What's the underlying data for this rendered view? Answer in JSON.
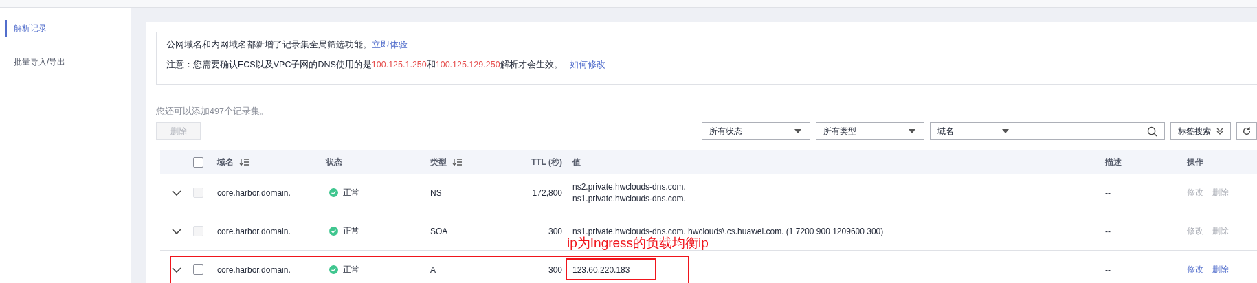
{
  "sidebar": {
    "items": [
      {
        "label": "解析记录",
        "selected": true
      },
      {
        "label": "批量导入/导出",
        "selected": false
      }
    ]
  },
  "notice": {
    "line_1": {
      "text": "公网域名和内网域名都新增了记录集全局筛选功能。",
      "link": "立即体验"
    },
    "line_2": {
      "parts": [
        {
          "kind": "text",
          "text": "注意：您需要确认ECS以及VPC子网的DNS使用的是"
        },
        {
          "kind": "highlight",
          "text": "100.125.1.250"
        },
        {
          "kind": "text",
          "text": "和"
        },
        {
          "kind": "highlight",
          "text": "100.125.129.250"
        },
        {
          "kind": "text",
          "text": "解析才会生效。"
        }
      ],
      "link": "如何修改"
    }
  },
  "quota": "您还可以添加497个记录集。",
  "delete_button": {
    "label": "删除",
    "disabled": true
  },
  "filters": {
    "status_select": "所有状态",
    "type_select": "所有类型",
    "search_scope": "域名",
    "tag_search": "标签搜索"
  },
  "table": {
    "select_all_checked": false,
    "columns": [
      {
        "label": "域名",
        "sortable": true
      },
      {
        "label": "状态",
        "sortable": false
      },
      {
        "label": "类型",
        "sortable": true
      },
      {
        "label": "TTL (秒)",
        "sortable": false
      },
      {
        "label": "值",
        "sortable": false
      },
      {
        "label": "描述",
        "sortable": false
      },
      {
        "label": "操作",
        "sortable": false
      }
    ],
    "rows": [
      {
        "domain": "core.harbor.domain.",
        "status": "正常",
        "type": "NS",
        "ttl": "172,800",
        "value": [
          "ns2.private.hwclouds-dns.com.",
          "ns1.private.hwclouds-dns.com."
        ],
        "description": "--",
        "actions": [
          "修改",
          "删除"
        ],
        "disabled": true,
        "annotated": false
      },
      {
        "domain": "core.harbor.domain.",
        "status": "正常",
        "type": "SOA",
        "ttl": "300",
        "value": [
          "ns1.private.hwclouds-dns.com. hwclouds\\.cs.huawei.com. (1 7200 900 1209600 300)"
        ],
        "description": "--",
        "actions": [
          "修改",
          "删除"
        ],
        "disabled": true,
        "annotated": false
      },
      {
        "domain": "core.harbor.domain.",
        "status": "正常",
        "type": "A",
        "ttl": "300",
        "value": [
          "123.60.220.183"
        ],
        "description": "--",
        "actions": [
          "修改",
          "删除"
        ],
        "disabled": false,
        "annotated": true
      }
    ]
  },
  "annotation": {
    "text": "ip为Ingress的负载均衡ip"
  }
}
